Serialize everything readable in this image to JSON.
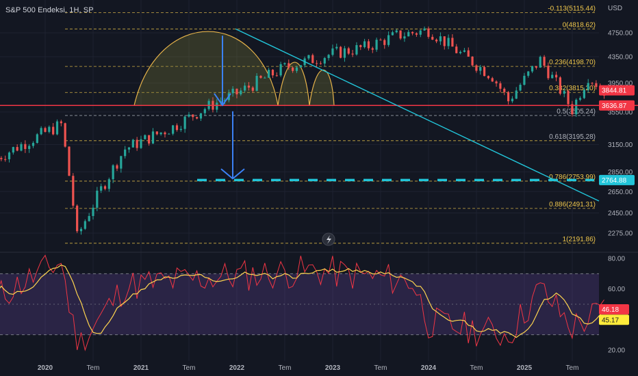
{
  "header": {
    "title": "S&P 500 Endeksi, 1H, SP"
  },
  "price_axis": {
    "unit": "USD",
    "ticks": [
      4750.0,
      4350.0,
      3950.0,
      3550.0,
      3150.0,
      2850.0,
      2650.0,
      2450.0,
      2275.0
    ],
    "tick_labels": [
      "4750.00",
      "4350.00",
      "3950.00",
      "3550.00",
      "3150.00",
      "2850.00",
      "2650.00",
      "2450.00",
      "2275.00"
    ]
  },
  "rsi_axis": {
    "ticks": [
      80,
      60,
      20
    ],
    "tick_labels": [
      "80.00",
      "60.00",
      "20.00"
    ],
    "upper_band": 70,
    "lower_band": 30
  },
  "time_axis": {
    "labels": [
      "2020",
      "Tem",
      "2021",
      "Tem",
      "2022",
      "Tem",
      "2023",
      "Tem",
      "2024",
      "Tem",
      "2025",
      "Tem"
    ],
    "bold": [
      true,
      false,
      true,
      false,
      true,
      false,
      true,
      false,
      true,
      false,
      true,
      false
    ]
  },
  "fib_levels": [
    {
      "label": "-0.113(5115.44)",
      "price": 5115.44
    },
    {
      "label": "0(4818.62)",
      "price": 4818.62
    },
    {
      "label": "0.236(4198.70)",
      "price": 4198.7
    },
    {
      "label": "0.382(3815.20)",
      "price": 3815.2
    },
    {
      "label": "0.5(3505.24)",
      "price": 3505.24
    },
    {
      "label": "0.618(3195.28)",
      "price": 3195.28
    },
    {
      "label": "0.786(2753.99)",
      "price": 2753.99
    },
    {
      "label": "0.886(2491.31)",
      "price": 2491.31
    },
    {
      "label": "1(2191.86)",
      "price": 2191.86
    }
  ],
  "price_tags": [
    {
      "label": "3844.81",
      "price": 3844.81,
      "color": "#f23645"
    },
    {
      "label": "3636.87",
      "price": 3636.87,
      "color": "#f23645"
    },
    {
      "label": "2764.88",
      "price": 2764.88,
      "color": "#22c5d9"
    }
  ],
  "rsi_tags": [
    {
      "label": "46.18",
      "value": 46.18,
      "color": "#f23645"
    },
    {
      "label": "45.17",
      "value": 45.17,
      "color": "#ffeb3b"
    }
  ],
  "colors": {
    "background": "#131722",
    "up": "#26a69a",
    "down": "#ef5350",
    "neckline": "#f23645",
    "trendline": "#22c5d9",
    "target": "#22c5d9",
    "arrow": "#3b82f6",
    "arc": "#e6b34a",
    "rsi": "#f23645",
    "rsi_ma": "#ffd54f",
    "rsi_band": "#7e57c2"
  },
  "chart_data": {
    "type": "candlestick",
    "title": "S&P 500 Endeksi, 1H, SP",
    "ylabel": "USD",
    "ylim": [
      2150,
      5130
    ],
    "x_range": [
      "2019-10",
      "2025-10"
    ],
    "key_points": [
      {
        "date": "2019-10",
        "close": 3000
      },
      {
        "date": "2020-02",
        "close": 3390
      },
      {
        "date": "2020-03",
        "close": 2240
      },
      {
        "date": "2020-06",
        "close": 3100
      },
      {
        "date": "2020-09",
        "close": 3360
      },
      {
        "date": "2020-11",
        "close": 3600
      },
      {
        "date": "2021-01",
        "close": 3800
      },
      {
        "date": "2021-04",
        "close": 4180
      },
      {
        "date": "2021-07",
        "close": 4400
      },
      {
        "date": "2021-09",
        "close": 4500
      },
      {
        "date": "2021-11",
        "close": 4700
      },
      {
        "date": "2022-01",
        "close": 4800
      },
      {
        "date": "2022-03",
        "close": 4400
      },
      {
        "date": "2022-05",
        "close": 4050
      },
      {
        "date": "2022-06",
        "close": 3700
      },
      {
        "date": "2022-08",
        "close": 4300
      },
      {
        "date": "2022-10",
        "close": 3580
      },
      {
        "date": "2022-11",
        "close": 4050
      },
      {
        "date": "2022-12",
        "close": 3840
      }
    ],
    "neckline": 3636.87,
    "target": 2764.88,
    "rsi": {
      "key_points": [
        {
          "date": "2019-10",
          "value": 55
        },
        {
          "date": "2020-02",
          "value": 78
        },
        {
          "date": "2020-03",
          "value": 22
        },
        {
          "date": "2020-06",
          "value": 62
        },
        {
          "date": "2020-12",
          "value": 68
        },
        {
          "date": "2021-06",
          "value": 72
        },
        {
          "date": "2021-12",
          "value": 65
        },
        {
          "date": "2022-01",
          "value": 38
        },
        {
          "date": "2022-06",
          "value": 30
        },
        {
          "date": "2022-08",
          "value": 60
        },
        {
          "date": "2022-10",
          "value": 35
        },
        {
          "date": "2022-12",
          "value": 46.18
        }
      ],
      "last": 46.18,
      "ma_last": 45.17
    }
  }
}
